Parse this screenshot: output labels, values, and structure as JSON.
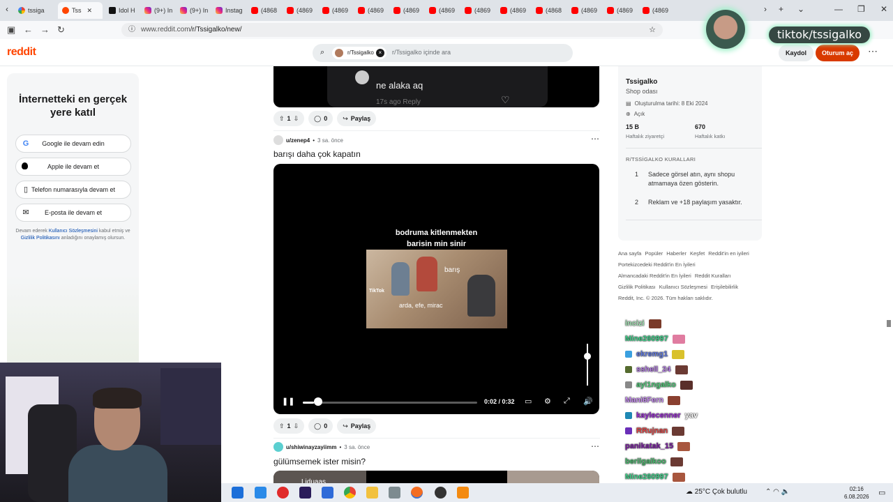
{
  "browser": {
    "tabs": [
      {
        "label": "tssiga",
        "fav": "g"
      },
      {
        "label": "Tss",
        "fav": "r",
        "active": true
      },
      {
        "label": "Idol H",
        "fav": "t"
      },
      {
        "label": "(9+) In",
        "fav": "i"
      },
      {
        "label": "(9+) In",
        "fav": "i"
      },
      {
        "label": "Instag",
        "fav": "i"
      },
      {
        "label": "(4868",
        "fav": "y"
      },
      {
        "label": "(4869",
        "fav": "y"
      },
      {
        "label": "(4869",
        "fav": "y"
      },
      {
        "label": "(4869",
        "fav": "y"
      },
      {
        "label": "(4869",
        "fav": "y"
      },
      {
        "label": "(4869",
        "fav": "y"
      },
      {
        "label": "(4869",
        "fav": "y"
      },
      {
        "label": "(4869",
        "fav": "y"
      },
      {
        "label": "(4868",
        "fav": "y"
      },
      {
        "label": "(4869",
        "fav": "y"
      },
      {
        "label": "(4869",
        "fav": "y"
      },
      {
        "label": "(4869",
        "fav": "y"
      }
    ],
    "url_host": "www.reddit.com",
    "url_path": "/r/Tssigalko/new/"
  },
  "reddit": {
    "logo": "reddit",
    "search_chip": "r/Tssigalko",
    "search_placeholder": "r/Tssigalko içinde ara",
    "signup_label": "Kaydol",
    "login_label": "Oturum aç"
  },
  "left_panel": {
    "heading": "İnternetteki en gerçek yere katıl",
    "buttons": [
      {
        "label": "Google ile devam edin",
        "icon": "G"
      },
      {
        "label": "Apple ile devam et",
        "icon": ""
      },
      {
        "label": "Telefon numarasıyla devam et",
        "icon": "▯"
      },
      {
        "label": "E-posta ile devam et",
        "icon": "✉"
      }
    ],
    "legal_prefix": "Devam ederek ",
    "legal_link1": "Kullanıcı Sözleşmesini",
    "legal_mid": " kabul etmiş ve ",
    "legal_link2": "Gizlilik Politikasını",
    "legal_suffix": " anladığını onaylamış olursun."
  },
  "posts": {
    "top_comment": {
      "text": "ne alaka aq",
      "sub": "17s ago   Reply"
    },
    "post1_actions": {
      "votes": "1",
      "comments": "0",
      "share": "Paylaş"
    },
    "post2": {
      "user": "u/zenep4",
      "time": "3 sa. önce",
      "title": "barışı daha çok kapatın",
      "video_caption_line1": "bodruma kitlenmekten",
      "video_caption_line2": "barisin min sinir",
      "frame_label1": "barış",
      "frame_label2": "arda, efe, mirac",
      "frame_tiktok": "TikTok",
      "time_display": "0:02 / 0:32",
      "progress": 0.0625,
      "votes": "1",
      "comments": "0",
      "share": "Paylaş"
    },
    "post3": {
      "user": "u/shiwinayzayiimm",
      "time": "3 sa. önce",
      "title": "gülümsemek ister misin?",
      "thumb_text": "Liduaas"
    }
  },
  "sidebar": {
    "name": "Tssigalko",
    "description": "Shop odası",
    "created": "Oluşturulma tarihi: 8 Eki 2024",
    "visibility": "Açık",
    "stat1_value": "15 B",
    "stat1_label": "Haftalık ziyaretçi",
    "stat2_value": "670",
    "stat2_label": "Haftalık katkı",
    "rules_heading": "R/TSSİGALKO KURALLARI",
    "rules": [
      {
        "n": "1",
        "text": "Sadece görsel atın, aynı shopu atmamaya özen gösterin."
      },
      {
        "n": "2",
        "text": "Reklam ve +18 paylaşım yasaktır."
      }
    ]
  },
  "footer_links": [
    "Ana sayfa",
    "Popüler",
    "Haberler",
    "Keşfet",
    "Reddit'in en iyileri",
    "Portekizcedeki Reddit'in En İyileri",
    "Almancadaki Reddit'in En İyileri",
    "Reddit Kuralları",
    "Gizlilik Politikası",
    "Kullanıcı Sözleşmesi",
    "Erişilebilirlik",
    "Reddit, Inc. © 2026. Tüm hakları saklıdır."
  ],
  "overlay": {
    "tiktok_handle": "tiktok/tssigalko"
  },
  "chat": [
    {
      "user": "incizi",
      "color": "#a7e8b8",
      "msg": ""
    },
    {
      "user": "Mine260997",
      "color": "#3fd18a",
      "msg": ""
    },
    {
      "user": "ekremg1",
      "color": "#5f79e0",
      "msg": ""
    },
    {
      "user": "sshell_24",
      "color": "#b57de6",
      "msg": ""
    },
    {
      "user": "ayl1ngalko",
      "color": "#52c97a",
      "msg": ""
    },
    {
      "user": "Mani6Fern",
      "color": "#c68cf0",
      "msg": ""
    },
    {
      "user": "kaylecenner",
      "color": "#9b2fd4",
      "msg": "yav"
    },
    {
      "user": "RRujnan",
      "color": "#e04646",
      "msg": ""
    },
    {
      "user": "panikatak_15",
      "color": "#7a1fa0",
      "msg": ""
    },
    {
      "user": "berilgalkoo",
      "color": "#49b96d",
      "msg": ""
    },
    {
      "user": "Mine260997",
      "color": "#3fd18a",
      "msg": ""
    }
  ],
  "taskbar": {
    "weather_temp": "25°C",
    "weather_desc": "Çok bulutlu",
    "time": "02:16",
    "date": "6.08.2026"
  }
}
